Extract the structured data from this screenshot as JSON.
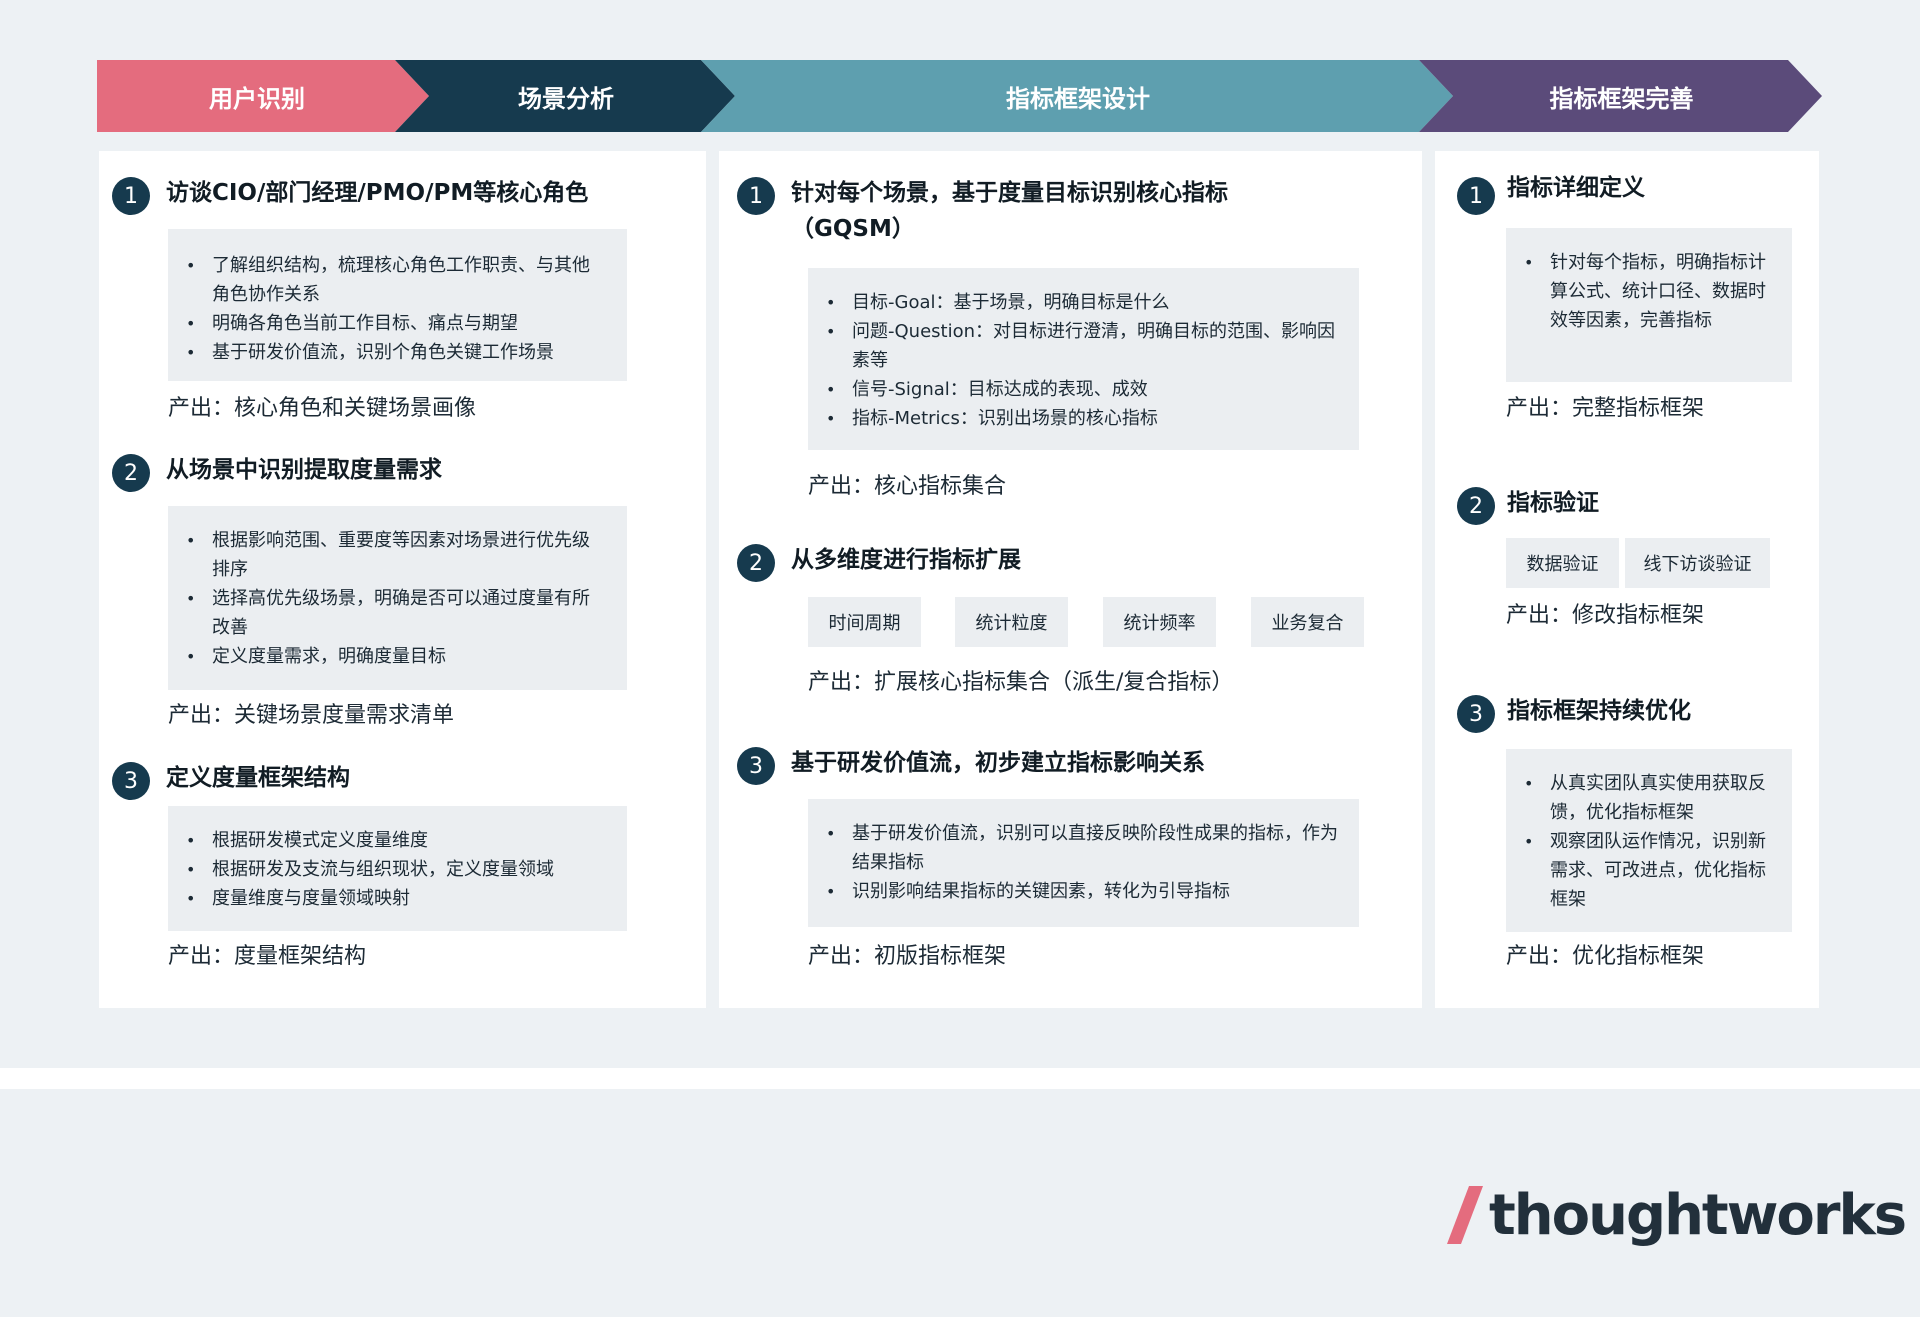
{
  "header": {
    "stages": [
      {
        "label": "用户识别",
        "color": "#e46c7e"
      },
      {
        "label": "场景分析",
        "color": "#163a4e"
      },
      {
        "label": "指标框架设计",
        "color": "#5e9faf"
      },
      {
        "label": "指标框架完善",
        "color": "#5b4b7a"
      }
    ]
  },
  "col1": {
    "s1": {
      "num": "1",
      "title": "访谈CIO/部门经理/PMO/PM等核心角色",
      "bullets": [
        "了解组织结构，梳理核心角色工作职责、与其他角色协作关系",
        "明确各角色当前工作目标、痛点与期望",
        "基于研发价值流，识别个角色关键工作场景"
      ],
      "output": "产出：核心角色和关键场景画像"
    },
    "s2": {
      "num": "2",
      "title": "从场景中识别提取度量需求",
      "bullets": [
        "根据影响范围、重要度等因素对场景进行优先级排序",
        "选择高优先级场景，明确是否可以通过度量有所改善",
        "定义度量需求，明确度量目标"
      ],
      "output": "产出：关键场景度量需求清单"
    },
    "s3": {
      "num": "3",
      "title": "定义度量框架结构",
      "bullets": [
        "根据研发模式定义度量维度",
        "根据研发及支流与组织现状，定义度量领域",
        "度量维度与度量领域映射"
      ],
      "output": "产出：度量框架结构"
    }
  },
  "col2": {
    "s1": {
      "num": "1",
      "title_line1": "针对每个场景，基于度量目标识别核心指标",
      "title_line2": "（GQSM）",
      "bullets": [
        "目标-Goal：基于场景，明确目标是什么",
        "问题-Question：对目标进行澄清，明确目标的范围、影响因素等",
        "信号-Signal：目标达成的表现、成效",
        "指标-Metrics：识别出场景的核心指标"
      ],
      "output": "产出：核心指标集合"
    },
    "s2": {
      "num": "2",
      "title": "从多维度进行指标扩展",
      "tags": [
        "时间周期",
        "统计粒度",
        "统计频率",
        "业务复合"
      ],
      "output": "产出：扩展核心指标集合（派生/复合指标）"
    },
    "s3": {
      "num": "3",
      "title": "基于研发价值流，初步建立指标影响关系",
      "bullets": [
        "基于研发价值流，识别可以直接反映阶段性成果的指标，作为结果指标",
        "识别影响结果指标的关键因素，转化为引导指标"
      ],
      "output": "产出：初版指标框架"
    }
  },
  "col3": {
    "s1": {
      "num": "1",
      "title": "指标详细定义",
      "bullets": [
        "针对每个指标，明确指标计算公式、统计口径、数据时效等因素，完善指标"
      ],
      "output": "产出：完整指标框架"
    },
    "s2": {
      "num": "2",
      "title": "指标验证",
      "tags": [
        "数据验证",
        "线下访谈验证"
      ],
      "output": "产出：修改指标框架"
    },
    "s3": {
      "num": "3",
      "title": "指标框架持续优化",
      "bullets": [
        "从真实团队真实使用获取反馈，优化指标框架",
        "观察团队运作情况，识别新需求、可改进点，优化指标框架"
      ],
      "output": "产出：优化指标框架"
    }
  },
  "logo": {
    "text": "thoughtworks",
    "slash_color": "#e46c7e",
    "text_color": "#22303b"
  }
}
